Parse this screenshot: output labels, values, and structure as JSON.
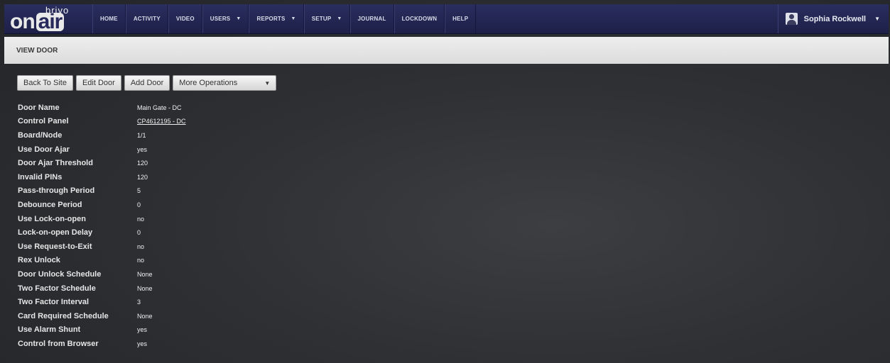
{
  "brand": {
    "small": "brivo",
    "main_on": "on",
    "main_air": "air"
  },
  "nav": {
    "items": [
      {
        "label": "HOME",
        "has_caret": false
      },
      {
        "label": "ACTIVITY",
        "has_caret": false
      },
      {
        "label": "VIDEO",
        "has_caret": false
      },
      {
        "label": "USERS",
        "has_caret": true
      },
      {
        "label": "REPORTS",
        "has_caret": true
      },
      {
        "label": "SETUP",
        "has_caret": true
      },
      {
        "label": "JOURNAL",
        "has_caret": false
      },
      {
        "label": "LOCKDOWN",
        "has_caret": false
      },
      {
        "label": "HELP",
        "has_caret": false
      }
    ],
    "user_name": "Sophia Rockwell"
  },
  "page_title": "VIEW DOOR",
  "toolbar": {
    "back": "Back To Site",
    "edit": "Edit Door",
    "add": "Add Door",
    "more": "More Operations"
  },
  "details": [
    {
      "label": "Door Name",
      "value": "Main Gate - DC"
    },
    {
      "label": "Control Panel",
      "value": "CP4612195 - DC",
      "link": true
    },
    {
      "label": "Board/Node",
      "value": "1/1"
    },
    {
      "label": "Use Door Ajar",
      "value": "yes"
    },
    {
      "label": "Door Ajar Threshold",
      "value": "120"
    },
    {
      "label": "Invalid PINs",
      "value": "120"
    },
    {
      "label": "Pass-through Period",
      "value": "5"
    },
    {
      "label": "Debounce Period",
      "value": "0"
    },
    {
      "label": "Use Lock-on-open",
      "value": "no"
    },
    {
      "label": "Lock-on-open Delay",
      "value": "0"
    },
    {
      "label": "Use Request-to-Exit",
      "value": "no"
    },
    {
      "label": "Rex Unlock",
      "value": "no"
    },
    {
      "label": "Door Unlock Schedule",
      "value": "None"
    },
    {
      "label": "Two Factor Schedule",
      "value": "None"
    },
    {
      "label": "Two Factor Interval",
      "value": "3"
    },
    {
      "label": "Card Required Schedule",
      "value": "None"
    },
    {
      "label": "Use Alarm Shunt",
      "value": "yes"
    },
    {
      "label": "Control from Browser",
      "value": "yes"
    }
  ],
  "colors": {
    "nav_bg": "#1d2048",
    "page_bg": "#2b2d31",
    "title_bg": "#e6e6e6"
  }
}
